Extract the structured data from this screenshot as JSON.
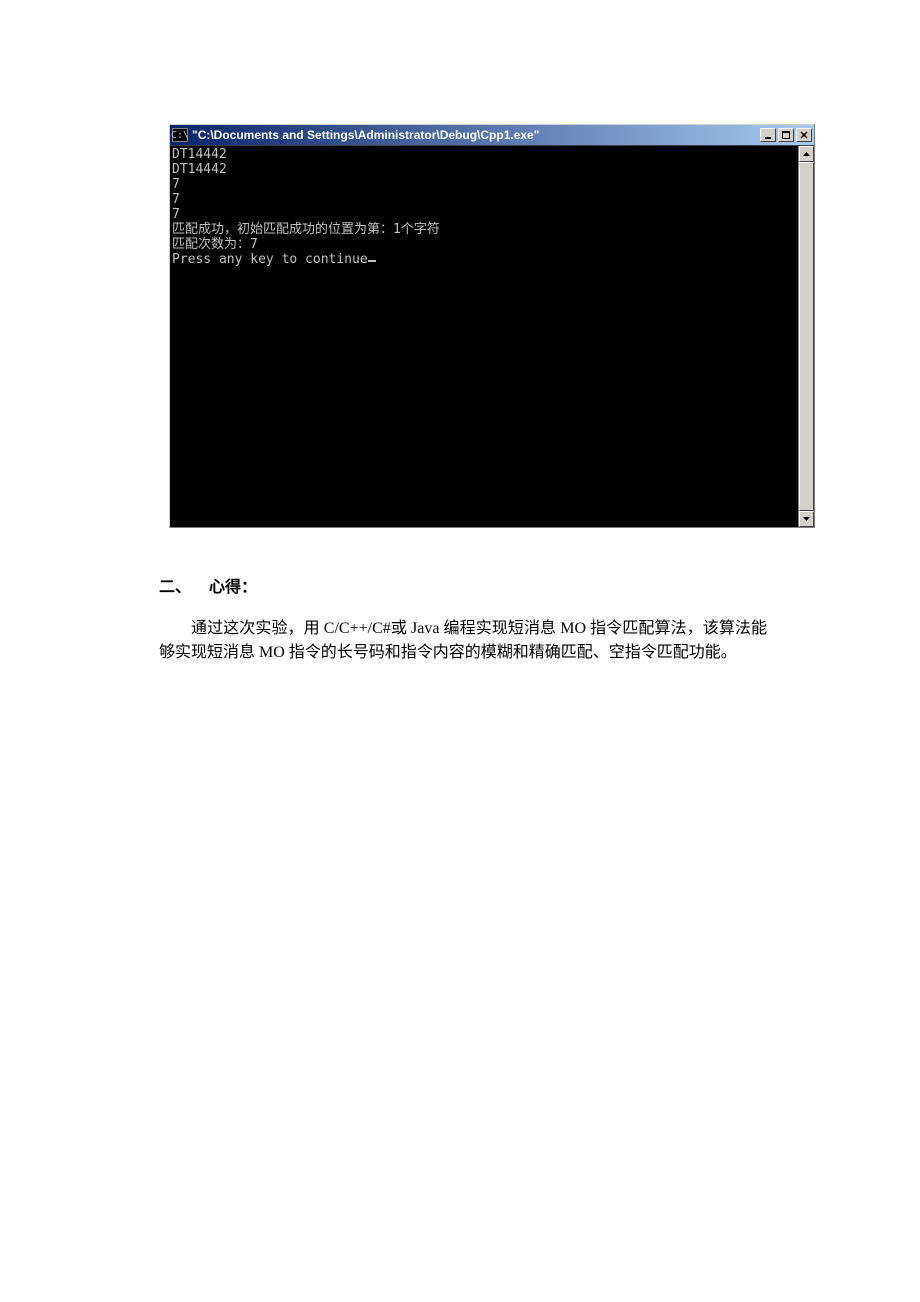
{
  "console": {
    "icon_label": "C:\\",
    "title": "\"C:\\Documents and Settings\\Administrator\\Debug\\Cpp1.exe\"",
    "lines": [
      "DT14442",
      "DT14442",
      "7",
      "7",
      "7",
      "匹配成功，初始匹配成功的位置为第：1个字符",
      "匹配次数为：7",
      "Press any key to continue"
    ]
  },
  "document": {
    "heading_number": "二、",
    "heading_text": "心得：",
    "paragraph": "通过这次实验，用 C/C++/C#或 Java 编程实现短消息 MO 指令匹配算法，该算法能够实现短消息 MO 指令的长号码和指令内容的模糊和精确匹配、空指令匹配功能。"
  }
}
